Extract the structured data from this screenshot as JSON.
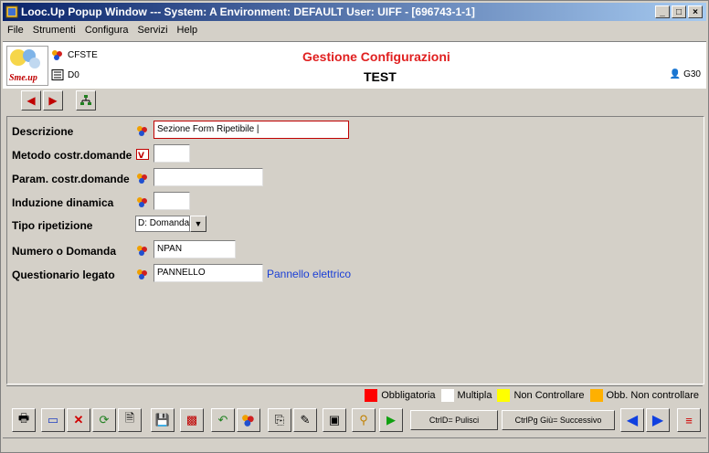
{
  "window": {
    "title": "Looc.Up Popup Window  ---  System: A Environment: DEFAULT User: UIFF - [696743-1-1]",
    "min": "_",
    "max": "□",
    "close": "×"
  },
  "menu": [
    "File",
    "Strumenti",
    "Configura",
    "Servizi",
    "Help"
  ],
  "header": {
    "logo_text": "Sme.up",
    "code1": "CFSTE",
    "code2": "D0",
    "title": "Gestione Configurazioni",
    "subtitle": "TEST",
    "user_code": "G30"
  },
  "form": {
    "fields": [
      {
        "label": "Descrizione",
        "value": "Sezione Form Ripetibile |"
      },
      {
        "label": "Metodo costr.domande",
        "value": ""
      },
      {
        "label": "Param. costr.domande",
        "value": ""
      },
      {
        "label": "Induzione dinamica",
        "value": ""
      },
      {
        "label": "Tipo ripetizione",
        "value": "D: Domanda"
      },
      {
        "label": "Numero o Domanda",
        "value": "NPAN"
      },
      {
        "label": "Questionario legato",
        "value": "PANNELLO",
        "description": "Pannello elettrico"
      }
    ]
  },
  "legend": [
    {
      "label": "Obbligatoria",
      "color": "#ff0000"
    },
    {
      "label": "Multipla",
      "color": "#ffffff"
    },
    {
      "label": "Non Controllare",
      "color": "#ffff00"
    },
    {
      "label": "Obb. Non controllare",
      "color": "#ffb000"
    }
  ],
  "buttons": {
    "clear": "CtrlD= Pulisci",
    "next": "CtrlPg Giù= Successivo"
  },
  "colors": {
    "accent": "#e02020",
    "link": "#1a3fd6",
    "titlebar": "#0a246a"
  }
}
